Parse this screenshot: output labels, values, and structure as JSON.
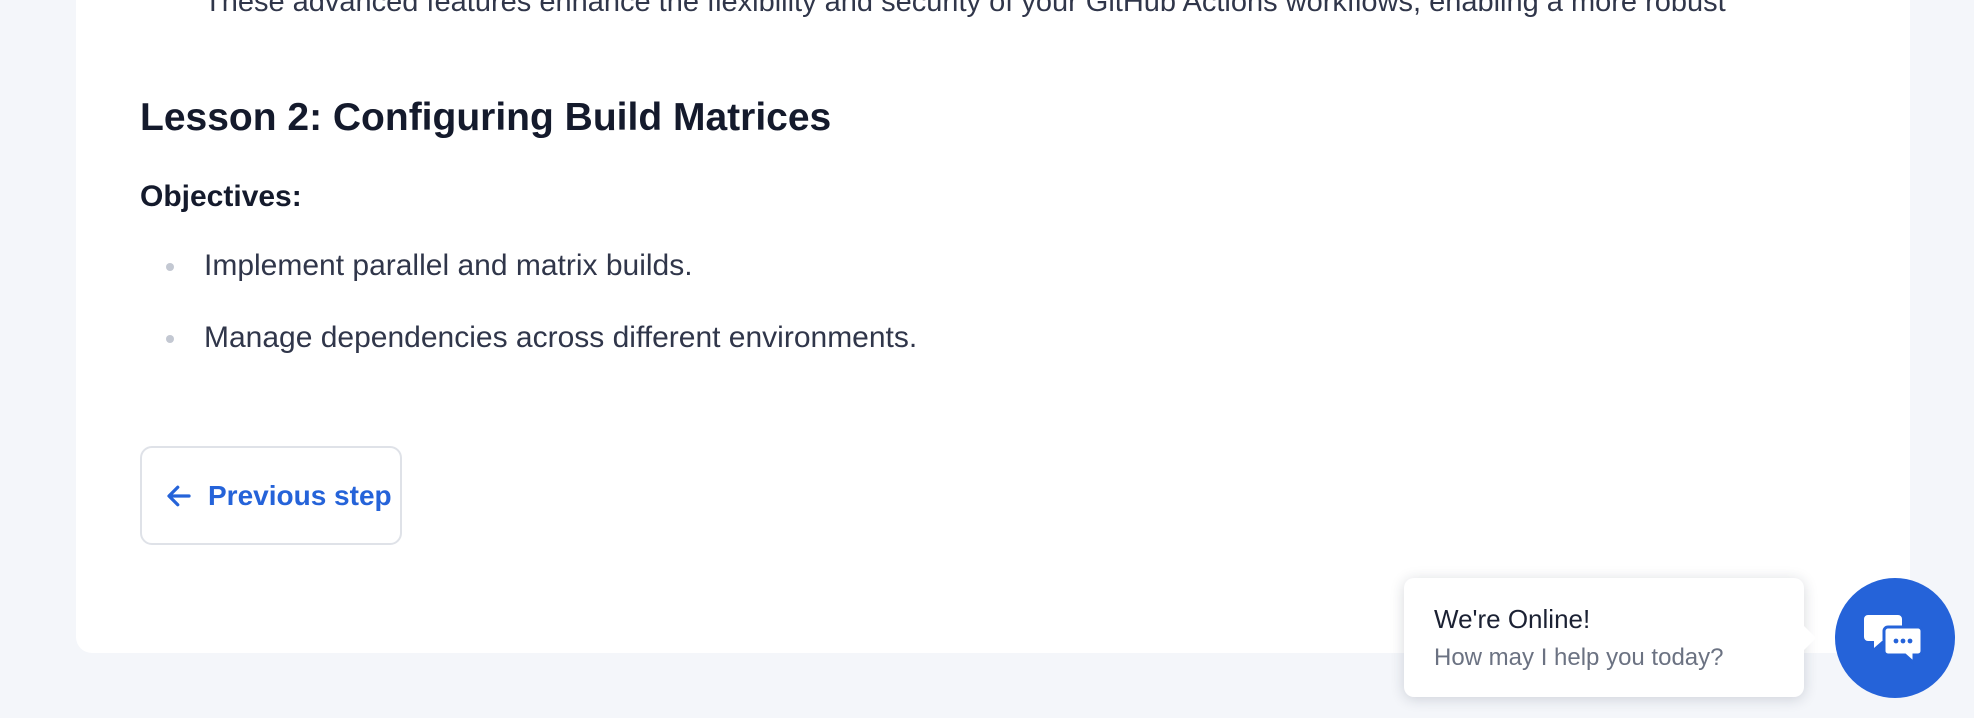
{
  "content": {
    "cut_off_line": "These advanced features enhance the flexibility and security of your GitHub Actions workflows, enabling a more robust",
    "lesson_title": "Lesson 2: Configuring Build Matrices",
    "objectives_label": "Objectives:",
    "objectives": [
      "Implement parallel and matrix builds.",
      "Manage dependencies across different environments."
    ]
  },
  "navigation": {
    "previous_label": "Previous step",
    "previous_icon": "arrow-left-icon"
  },
  "chat_widget": {
    "title": "We're Online!",
    "subtitle": "How may I help you today?",
    "launcher_icon": "chat-bubbles-icon"
  },
  "colors": {
    "accent": "#2563d9",
    "page_background": "#f4f6fa",
    "card_background": "#ffffff",
    "heading_text": "#141a2c",
    "body_text": "#30364a"
  }
}
